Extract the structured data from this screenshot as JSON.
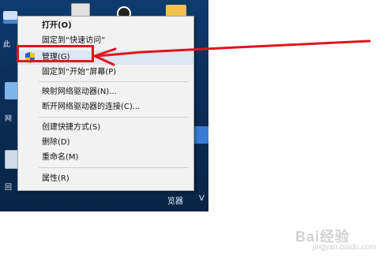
{
  "desktop": {
    "icons": {
      "this_pc_label": "此",
      "network_label": "网",
      "bin_label": "回",
      "browser_label": "览器",
      "browser_label2": "V"
    }
  },
  "context_menu": {
    "items": [
      {
        "label": "打开(O)"
      },
      {
        "label": "固定到“快速访问”"
      },
      {
        "label": "管理(G)"
      },
      {
        "label": "固定到“开始”屏幕(P)"
      },
      {
        "label": "映射网络驱动器(N)..."
      },
      {
        "label": "断开网络驱动器的连接(C)..."
      },
      {
        "label": "创建快捷方式(S)"
      },
      {
        "label": "删除(D)"
      },
      {
        "label": "重命名(M)"
      },
      {
        "label": "属性(R)"
      }
    ]
  },
  "annotation": {
    "color": "#e0141e"
  },
  "watermark": {
    "brand": "Bai经验",
    "url": "jingyan.baidu.com"
  },
  "icons": {
    "manage_icon": "uac-shield-icon"
  }
}
